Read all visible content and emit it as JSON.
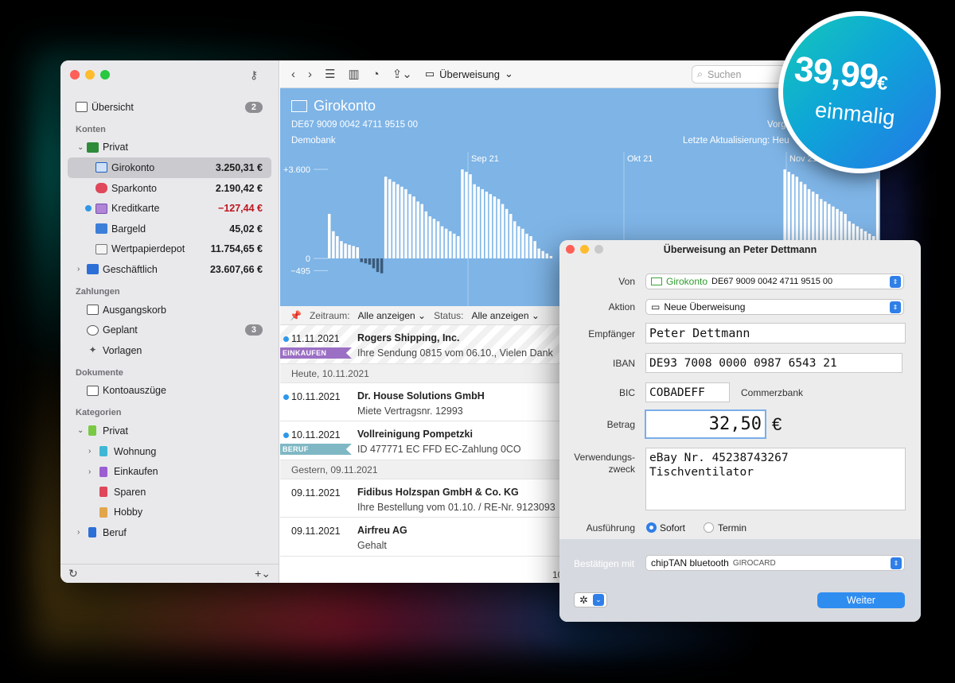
{
  "sidebar": {
    "overview": {
      "label": "Übersicht",
      "badge": "2"
    },
    "sections": {
      "konten": "Konten",
      "zahlungen": "Zahlungen",
      "dokumente": "Dokumente",
      "kategorien": "Kategorien"
    },
    "accounts": [
      {
        "label": "Privat"
      },
      {
        "label": "Girokonto",
        "amount": "3.250,31 €"
      },
      {
        "label": "Sparkonto",
        "amount": "2.190,42 €"
      },
      {
        "label": "Kreditkarte",
        "amount": "−127,44 €"
      },
      {
        "label": "Bargeld",
        "amount": "45,02 €"
      },
      {
        "label": "Wertpapierdepot",
        "amount": "11.754,65 €"
      },
      {
        "label": "Geschäftlich",
        "amount": "23.607,66 €"
      }
    ],
    "payments": [
      {
        "label": "Ausgangskorb"
      },
      {
        "label": "Geplant",
        "badge": "3"
      },
      {
        "label": "Vorlagen"
      }
    ],
    "documents": [
      {
        "label": "Kontoauszüge"
      }
    ],
    "categories": [
      {
        "label": "Privat"
      },
      {
        "label": "Wohnung"
      },
      {
        "label": "Einkaufen"
      },
      {
        "label": "Sparen"
      },
      {
        "label": "Hobby"
      },
      {
        "label": "Beruf"
      }
    ],
    "colors": {
      "wohnung": "#3fb7d4",
      "einkaufen": "#9b5fd1",
      "sparen": "#e0475a",
      "hobby": "#e2a64a",
      "privat": "#7ac943",
      "beruf": "#2c6fd6"
    }
  },
  "toolbar": {
    "title": "Überweisung",
    "search_placeholder": "Suchen"
  },
  "account": {
    "title": "Girokonto",
    "iban": "DE67 9009 0042 4711 9515 00",
    "bank": "Demobank",
    "vorg": "Vorg",
    "updated": "Letzte Aktualisierung: Heu"
  },
  "chart_data": {
    "type": "bar",
    "ytick_labels": [
      "+3.600",
      "0",
      "−495"
    ],
    "month_labels": [
      "Sep 21",
      "Okt 21",
      "Nov 21"
    ],
    "values": [
      1800,
      1100,
      900,
      700,
      600,
      550,
      500,
      450,
      -150,
      -200,
      -250,
      -400,
      -550,
      -600,
      3300,
      3200,
      3100,
      3000,
      2900,
      2800,
      2600,
      2500,
      2300,
      2200,
      1900,
      1700,
      1600,
      1500,
      1300,
      1200,
      1100,
      1000,
      900,
      3600,
      3500,
      3400,
      3000,
      2900,
      2800,
      2700,
      2600,
      2500,
      2400,
      2200,
      2000,
      1800,
      1500,
      1300,
      1200,
      1000,
      900,
      700,
      400,
      300,
      200,
      100,
      0,
      0,
      0,
      0,
      0,
      0,
      0,
      0,
      0,
      0,
      0,
      0,
      0,
      0,
      0,
      0,
      0,
      0,
      0,
      0,
      0,
      0,
      0,
      0,
      0,
      0,
      0,
      0,
      0,
      0,
      0,
      0,
      0,
      0,
      0,
      0,
      0,
      0,
      0,
      0,
      0,
      0,
      0,
      0,
      0,
      0,
      0,
      0,
      0,
      0,
      0,
      0,
      0,
      0,
      0,
      0,
      0,
      3600,
      3500,
      3400,
      3300,
      3100,
      3000,
      2800,
      2700,
      2600,
      2400,
      2300,
      2200,
      2100,
      2000,
      1900,
      1800,
      1500,
      1400,
      1300,
      1200,
      1100,
      1000,
      900,
      3200
    ],
    "bar_color": "#ffffff",
    "bg_color": "#7eb4e6"
  },
  "filters": {
    "period_label": "Zeitraum:",
    "period_value": "Alle anzeigen",
    "status_label": "Status:",
    "status_value": "Alle anzeigen"
  },
  "transactions": [
    {
      "date": "11.11.2021",
      "name": "Rogers Shipping, Inc.",
      "desc": "Ihre Sendung 0815 vom 06.10., Vielen Dank",
      "tag": "EINKAUFEN",
      "tag_color": "#9b6fc4"
    },
    {
      "group": "Heute, 10.11.2021"
    },
    {
      "date": "10.11.2021",
      "name": "Dr. House Solutions GmbH",
      "desc": "Miete Vertragsnr. 12993"
    },
    {
      "date": "10.11.2021",
      "name": "Vollreinigung Pompetzki",
      "desc": "ID 477771 EC FFD EC-Zahlung 0CO",
      "tag": "BERUF",
      "tag_color": "#7fb8c4"
    },
    {
      "group": "Gestern, 09.11.2021"
    },
    {
      "date": "09.11.2021",
      "name": "Fidibus Holzspan GmbH & Co. KG",
      "desc": "Ihre Bestellung vom 01.10. / RE-Nr. 9123093"
    },
    {
      "date": "09.11.2021",
      "name": "Airfreu AG",
      "desc": "Gehalt"
    }
  ],
  "list_count": "10",
  "dialog": {
    "title": "Überweisung an Peter Dettmann",
    "von_label": "Von",
    "von_account": "Girokonto",
    "von_iban": "DE67 9009 0042 4711 9515 00",
    "aktion_label": "Aktion",
    "aktion_value": "Neue Überweisung",
    "empf_label": "Empfänger",
    "empf_value": "Peter Dettmann",
    "iban_label": "IBAN",
    "iban_value": "DE93 7008 0000 0987 6543 21",
    "bic_label": "BIC",
    "bic_value": "COBADEFF",
    "bank_name": "Commerzbank",
    "betrag_label": "Betrag",
    "betrag_value": "32,50",
    "currency": "€",
    "zweck_label1": "Verwendungs-",
    "zweck_label2": "zweck",
    "zweck_line1": "eBay Nr. 45238743267",
    "zweck_line2": "Tischventilator",
    "ausf_label": "Ausführung",
    "opt_sofort": "Sofort",
    "opt_termin": "Termin",
    "confirm_label": "Bestätigen mit",
    "tan_method": "chipTAN bluetooth",
    "tan_sub": "GIROCARD",
    "weiter": "Weiter"
  },
  "price": {
    "amount": "39,99",
    "currency": "€",
    "note": "einmalig"
  }
}
